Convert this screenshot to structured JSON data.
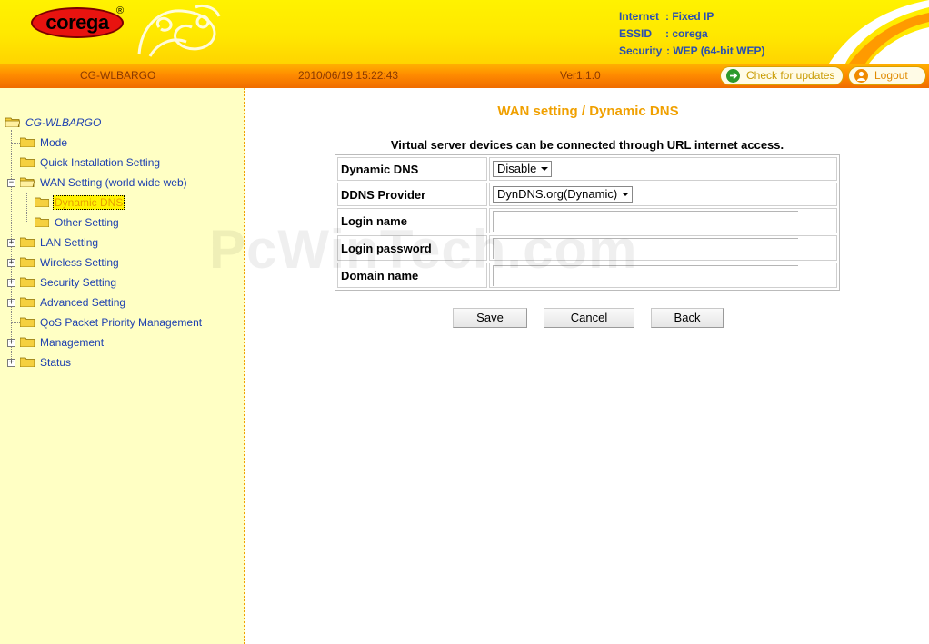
{
  "header": {
    "logo": "corega",
    "logo_reg": "®",
    "status": [
      {
        "key": "Internet",
        "value": "Fixed IP"
      },
      {
        "key": "ESSID",
        "value": "corega"
      },
      {
        "key": "Security",
        "value": "WEP (64-bit WEP)"
      }
    ]
  },
  "bar": {
    "device": "CG-WLBARGO",
    "datetime": "2010/06/19 15:22:43",
    "version": "Ver1.1.0",
    "check_updates": "Check for updates",
    "logout": "Logout"
  },
  "sidebar": {
    "root": "CG-WLBARGO",
    "items": [
      {
        "label": "Mode"
      },
      {
        "label": "Quick Installation Setting"
      },
      {
        "label": "WAN Setting (world wide web)"
      },
      {
        "label": "Dynamic DNS"
      },
      {
        "label": "Other Setting"
      },
      {
        "label": "LAN Setting"
      },
      {
        "label": "Wireless Setting"
      },
      {
        "label": "Security Setting"
      },
      {
        "label": "Advanced Setting"
      },
      {
        "label": "QoS Packet Priority Management"
      },
      {
        "label": "Management"
      },
      {
        "label": "Status"
      }
    ]
  },
  "main": {
    "title": "WAN setting / Dynamic DNS",
    "intro": "Virtual server devices can be connected through URL internet access.",
    "watermark": "PcWinTech.com",
    "form": {
      "dynamic_dns_label": "Dynamic DNS",
      "dynamic_dns_value": "Disable",
      "provider_label": "DDNS Provider",
      "provider_value": "DynDNS.org(Dynamic)",
      "login_name_label": "Login name",
      "login_name_value": "",
      "login_password_label": "Login password",
      "login_password_value": "",
      "domain_label": "Domain name",
      "domain_value": ""
    },
    "buttons": {
      "save": "Save",
      "cancel": "Cancel",
      "back": "Back"
    }
  },
  "colors": {
    "header_yellow": "#fff200",
    "bar_orange": "#ff8c00",
    "sidebar_bg": "#ffffc4",
    "link_blue": "#1d3fb0",
    "title_orange": "#f0a000"
  },
  "icons": [
    "folder-icon",
    "folder-open-icon",
    "expand-plus-icon",
    "collapse-minus-icon",
    "refresh-icon",
    "logout-icon"
  ]
}
